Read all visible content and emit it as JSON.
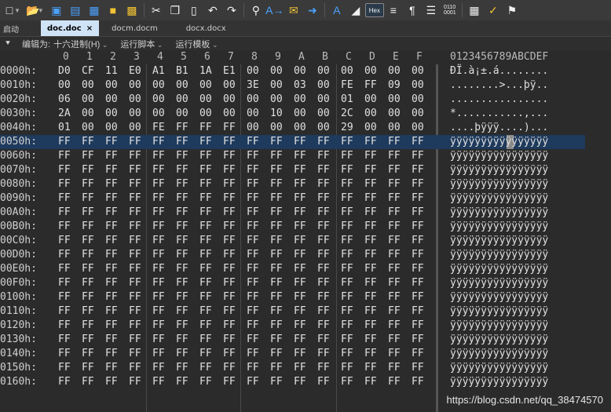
{
  "toolbar": {
    "icons": [
      "new-file-icon",
      "open-folder-icon",
      "save-icon",
      "save-as-icon",
      "save-all-icon",
      "folder-icon",
      "folders-icon",
      "cut-icon",
      "copy-icon",
      "paste-icon",
      "undo-icon",
      "redo-icon",
      "find-icon",
      "replace-icon",
      "speech-icon",
      "goto-icon",
      "font-icon",
      "eraser-icon",
      "hex-icon",
      "wrap-icon",
      "pilcrow-icon",
      "columns-icon",
      "binary-icon",
      "calculator-icon",
      "checklist-icon",
      "bookmark-icon"
    ]
  },
  "tabs": {
    "start": "启动",
    "items": [
      {
        "label": "doc.doc",
        "active": true,
        "close": "×"
      },
      {
        "label": "docm.docm",
        "active": false
      },
      {
        "label": "docx.docx",
        "active": false
      }
    ]
  },
  "menubar": {
    "arrow": "⯆",
    "edit_as_label": "编辑为:",
    "edit_as_value": "十六进制(H)",
    "run_script": "运行脚本",
    "run_template": "运行模板"
  },
  "hex": {
    "col_headers": [
      "0",
      "1",
      "2",
      "3",
      "4",
      "5",
      "6",
      "7",
      "8",
      "9",
      "A",
      "B",
      "C",
      "D",
      "E",
      "F"
    ],
    "ascii_header": "0123456789ABCDEF",
    "highlight_row": 5,
    "rows": [
      {
        "addr": "0000h:",
        "bytes": [
          "D0",
          "CF",
          "11",
          "E0",
          "A1",
          "B1",
          "1A",
          "E1",
          "00",
          "00",
          "00",
          "00",
          "00",
          "00",
          "00",
          "00"
        ],
        "ascii": "ÐÏ.à¡±.á........"
      },
      {
        "addr": "0010h:",
        "bytes": [
          "00",
          "00",
          "00",
          "00",
          "00",
          "00",
          "00",
          "00",
          "3E",
          "00",
          "03",
          "00",
          "FE",
          "FF",
          "09",
          "00"
        ],
        "ascii": "........>...þÿ.."
      },
      {
        "addr": "0020h:",
        "bytes": [
          "06",
          "00",
          "00",
          "00",
          "00",
          "00",
          "00",
          "00",
          "00",
          "00",
          "00",
          "00",
          "01",
          "00",
          "00",
          "00"
        ],
        "ascii": "................"
      },
      {
        "addr": "0030h:",
        "bytes": [
          "2A",
          "00",
          "00",
          "00",
          "00",
          "00",
          "00",
          "00",
          "00",
          "10",
          "00",
          "00",
          "2C",
          "00",
          "00",
          "00"
        ],
        "ascii": "*...........,..."
      },
      {
        "addr": "0040h:",
        "bytes": [
          "01",
          "00",
          "00",
          "00",
          "FE",
          "FF",
          "FF",
          "FF",
          "00",
          "00",
          "00",
          "00",
          "29",
          "00",
          "00",
          "00"
        ],
        "ascii": "....þÿÿÿ....)..."
      },
      {
        "addr": "0050h:",
        "bytes": [
          "FF",
          "FF",
          "FF",
          "FF",
          "FF",
          "FF",
          "FF",
          "FF",
          "FF",
          "FF",
          "FF",
          "FF",
          "FF",
          "FF",
          "FF",
          "FF"
        ],
        "ascii": "ÿÿÿÿÿÿÿÿÿÿÿÿÿÿÿÿ"
      },
      {
        "addr": "0060h:",
        "bytes": [
          "FF",
          "FF",
          "FF",
          "FF",
          "FF",
          "FF",
          "FF",
          "FF",
          "FF",
          "FF",
          "FF",
          "FF",
          "FF",
          "FF",
          "FF",
          "FF"
        ],
        "ascii": "ÿÿÿÿÿÿÿÿÿÿÿÿÿÿÿÿ"
      },
      {
        "addr": "0070h:",
        "bytes": [
          "FF",
          "FF",
          "FF",
          "FF",
          "FF",
          "FF",
          "FF",
          "FF",
          "FF",
          "FF",
          "FF",
          "FF",
          "FF",
          "FF",
          "FF",
          "FF"
        ],
        "ascii": "ÿÿÿÿÿÿÿÿÿÿÿÿÿÿÿÿ"
      },
      {
        "addr": "0080h:",
        "bytes": [
          "FF",
          "FF",
          "FF",
          "FF",
          "FF",
          "FF",
          "FF",
          "FF",
          "FF",
          "FF",
          "FF",
          "FF",
          "FF",
          "FF",
          "FF",
          "FF"
        ],
        "ascii": "ÿÿÿÿÿÿÿÿÿÿÿÿÿÿÿÿ"
      },
      {
        "addr": "0090h:",
        "bytes": [
          "FF",
          "FF",
          "FF",
          "FF",
          "FF",
          "FF",
          "FF",
          "FF",
          "FF",
          "FF",
          "FF",
          "FF",
          "FF",
          "FF",
          "FF",
          "FF"
        ],
        "ascii": "ÿÿÿÿÿÿÿÿÿÿÿÿÿÿÿÿ"
      },
      {
        "addr": "00A0h:",
        "bytes": [
          "FF",
          "FF",
          "FF",
          "FF",
          "FF",
          "FF",
          "FF",
          "FF",
          "FF",
          "FF",
          "FF",
          "FF",
          "FF",
          "FF",
          "FF",
          "FF"
        ],
        "ascii": "ÿÿÿÿÿÿÿÿÿÿÿÿÿÿÿÿ"
      },
      {
        "addr": "00B0h:",
        "bytes": [
          "FF",
          "FF",
          "FF",
          "FF",
          "FF",
          "FF",
          "FF",
          "FF",
          "FF",
          "FF",
          "FF",
          "FF",
          "FF",
          "FF",
          "FF",
          "FF"
        ],
        "ascii": "ÿÿÿÿÿÿÿÿÿÿÿÿÿÿÿÿ"
      },
      {
        "addr": "00C0h:",
        "bytes": [
          "FF",
          "FF",
          "FF",
          "FF",
          "FF",
          "FF",
          "FF",
          "FF",
          "FF",
          "FF",
          "FF",
          "FF",
          "FF",
          "FF",
          "FF",
          "FF"
        ],
        "ascii": "ÿÿÿÿÿÿÿÿÿÿÿÿÿÿÿÿ"
      },
      {
        "addr": "00D0h:",
        "bytes": [
          "FF",
          "FF",
          "FF",
          "FF",
          "FF",
          "FF",
          "FF",
          "FF",
          "FF",
          "FF",
          "FF",
          "FF",
          "FF",
          "FF",
          "FF",
          "FF"
        ],
        "ascii": "ÿÿÿÿÿÿÿÿÿÿÿÿÿÿÿÿ"
      },
      {
        "addr": "00E0h:",
        "bytes": [
          "FF",
          "FF",
          "FF",
          "FF",
          "FF",
          "FF",
          "FF",
          "FF",
          "FF",
          "FF",
          "FF",
          "FF",
          "FF",
          "FF",
          "FF",
          "FF"
        ],
        "ascii": "ÿÿÿÿÿÿÿÿÿÿÿÿÿÿÿÿ"
      },
      {
        "addr": "00F0h:",
        "bytes": [
          "FF",
          "FF",
          "FF",
          "FF",
          "FF",
          "FF",
          "FF",
          "FF",
          "FF",
          "FF",
          "FF",
          "FF",
          "FF",
          "FF",
          "FF",
          "FF"
        ],
        "ascii": "ÿÿÿÿÿÿÿÿÿÿÿÿÿÿÿÿ"
      },
      {
        "addr": "0100h:",
        "bytes": [
          "FF",
          "FF",
          "FF",
          "FF",
          "FF",
          "FF",
          "FF",
          "FF",
          "FF",
          "FF",
          "FF",
          "FF",
          "FF",
          "FF",
          "FF",
          "FF"
        ],
        "ascii": "ÿÿÿÿÿÿÿÿÿÿÿÿÿÿÿÿ"
      },
      {
        "addr": "0110h:",
        "bytes": [
          "FF",
          "FF",
          "FF",
          "FF",
          "FF",
          "FF",
          "FF",
          "FF",
          "FF",
          "FF",
          "FF",
          "FF",
          "FF",
          "FF",
          "FF",
          "FF"
        ],
        "ascii": "ÿÿÿÿÿÿÿÿÿÿÿÿÿÿÿÿ"
      },
      {
        "addr": "0120h:",
        "bytes": [
          "FF",
          "FF",
          "FF",
          "FF",
          "FF",
          "FF",
          "FF",
          "FF",
          "FF",
          "FF",
          "FF",
          "FF",
          "FF",
          "FF",
          "FF",
          "FF"
        ],
        "ascii": "ÿÿÿÿÿÿÿÿÿÿÿÿÿÿÿÿ"
      },
      {
        "addr": "0130h:",
        "bytes": [
          "FF",
          "FF",
          "FF",
          "FF",
          "FF",
          "FF",
          "FF",
          "FF",
          "FF",
          "FF",
          "FF",
          "FF",
          "FF",
          "FF",
          "FF",
          "FF"
        ],
        "ascii": "ÿÿÿÿÿÿÿÿÿÿÿÿÿÿÿÿ"
      },
      {
        "addr": "0140h:",
        "bytes": [
          "FF",
          "FF",
          "FF",
          "FF",
          "FF",
          "FF",
          "FF",
          "FF",
          "FF",
          "FF",
          "FF",
          "FF",
          "FF",
          "FF",
          "FF",
          "FF"
        ],
        "ascii": "ÿÿÿÿÿÿÿÿÿÿÿÿÿÿÿÿ"
      },
      {
        "addr": "0150h:",
        "bytes": [
          "FF",
          "FF",
          "FF",
          "FF",
          "FF",
          "FF",
          "FF",
          "FF",
          "FF",
          "FF",
          "FF",
          "FF",
          "FF",
          "FF",
          "FF",
          "FF"
        ],
        "ascii": "ÿÿÿÿÿÿÿÿÿÿÿÿÿÿÿÿ"
      },
      {
        "addr": "0160h:",
        "bytes": [
          "FF",
          "FF",
          "FF",
          "FF",
          "FF",
          "FF",
          "FF",
          "FF",
          "FF",
          "FF",
          "FF",
          "FF",
          "FF",
          "FF",
          "FF",
          "FF"
        ],
        "ascii": "ÿÿÿÿÿÿÿÿÿÿÿÿÿÿÿÿ"
      }
    ]
  },
  "watermark": "https://blog.csdn.net/qq_38474570"
}
